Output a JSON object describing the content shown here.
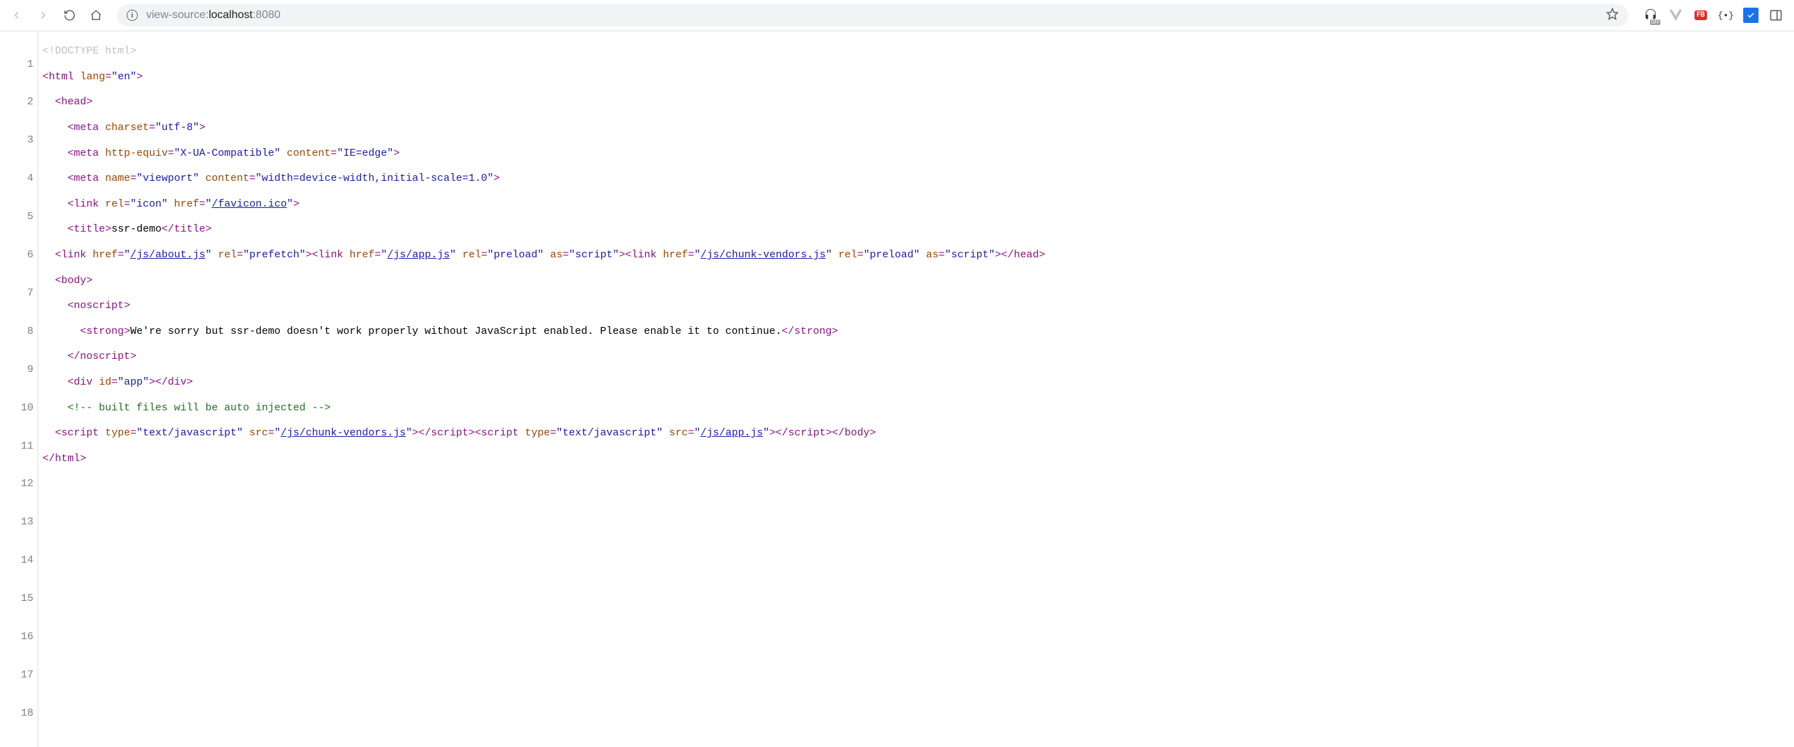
{
  "toolbar": {
    "url_prefix": "view-source:",
    "url_host": "localhost",
    "url_port": ":8080"
  },
  "ext_off_label": "OFF",
  "ext_fb_label": "FB",
  "code": {
    "lines": [
      "1",
      "2",
      "3",
      "4",
      "5",
      "6",
      "7",
      "8",
      "9",
      "10",
      "11",
      "12",
      "13",
      "14",
      "15",
      "16",
      "17",
      "18"
    ],
    "l1_doctype": "<!DOCTYPE html>",
    "html_tag": "html",
    "lang_attr": "lang",
    "lang_val": "\"en\"",
    "head_tag": "head",
    "meta_tag": "meta",
    "charset_attr": "charset",
    "charset_val": "\"utf-8\"",
    "httpequiv_attr": "http-equiv",
    "httpequiv_val": "\"X-UA-Compatible\"",
    "content_attr": "content",
    "content_ie_val": "\"IE=edge\"",
    "name_attr": "name",
    "viewport_val": "\"viewport\"",
    "content_vp_val": "\"width=device-width,initial-scale=1.0\"",
    "link_tag": "link",
    "rel_attr": "rel",
    "rel_icon_val": "\"icon\"",
    "href_attr": "href",
    "favicon_href_q": "\"",
    "favicon_href": "/favicon.ico",
    "title_tag": "title",
    "title_text": "ssr-demo",
    "about_href": "/js/about.js",
    "rel_prefetch_val": "\"prefetch\"",
    "app_href": "/js/app.js",
    "rel_preload_val": "\"preload\"",
    "as_attr": "as",
    "as_script_val": "\"script\"",
    "chunk_href": "/js/chunk-vendors.js",
    "body_tag": "body",
    "noscript_tag": "noscript",
    "strong_tag": "strong",
    "noscript_text": "We're sorry but ssr-demo doesn't work properly without JavaScript enabled. Please enable it to continue.",
    "div_tag": "div",
    "id_attr": "id",
    "id_app_val": "\"app\"",
    "comment_text": "<!-- built files will be auto injected -->",
    "script_tag": "script",
    "type_attr": "type",
    "type_js_val": "\"text/javascript\"",
    "src_attr": "src",
    "q": "\""
  }
}
